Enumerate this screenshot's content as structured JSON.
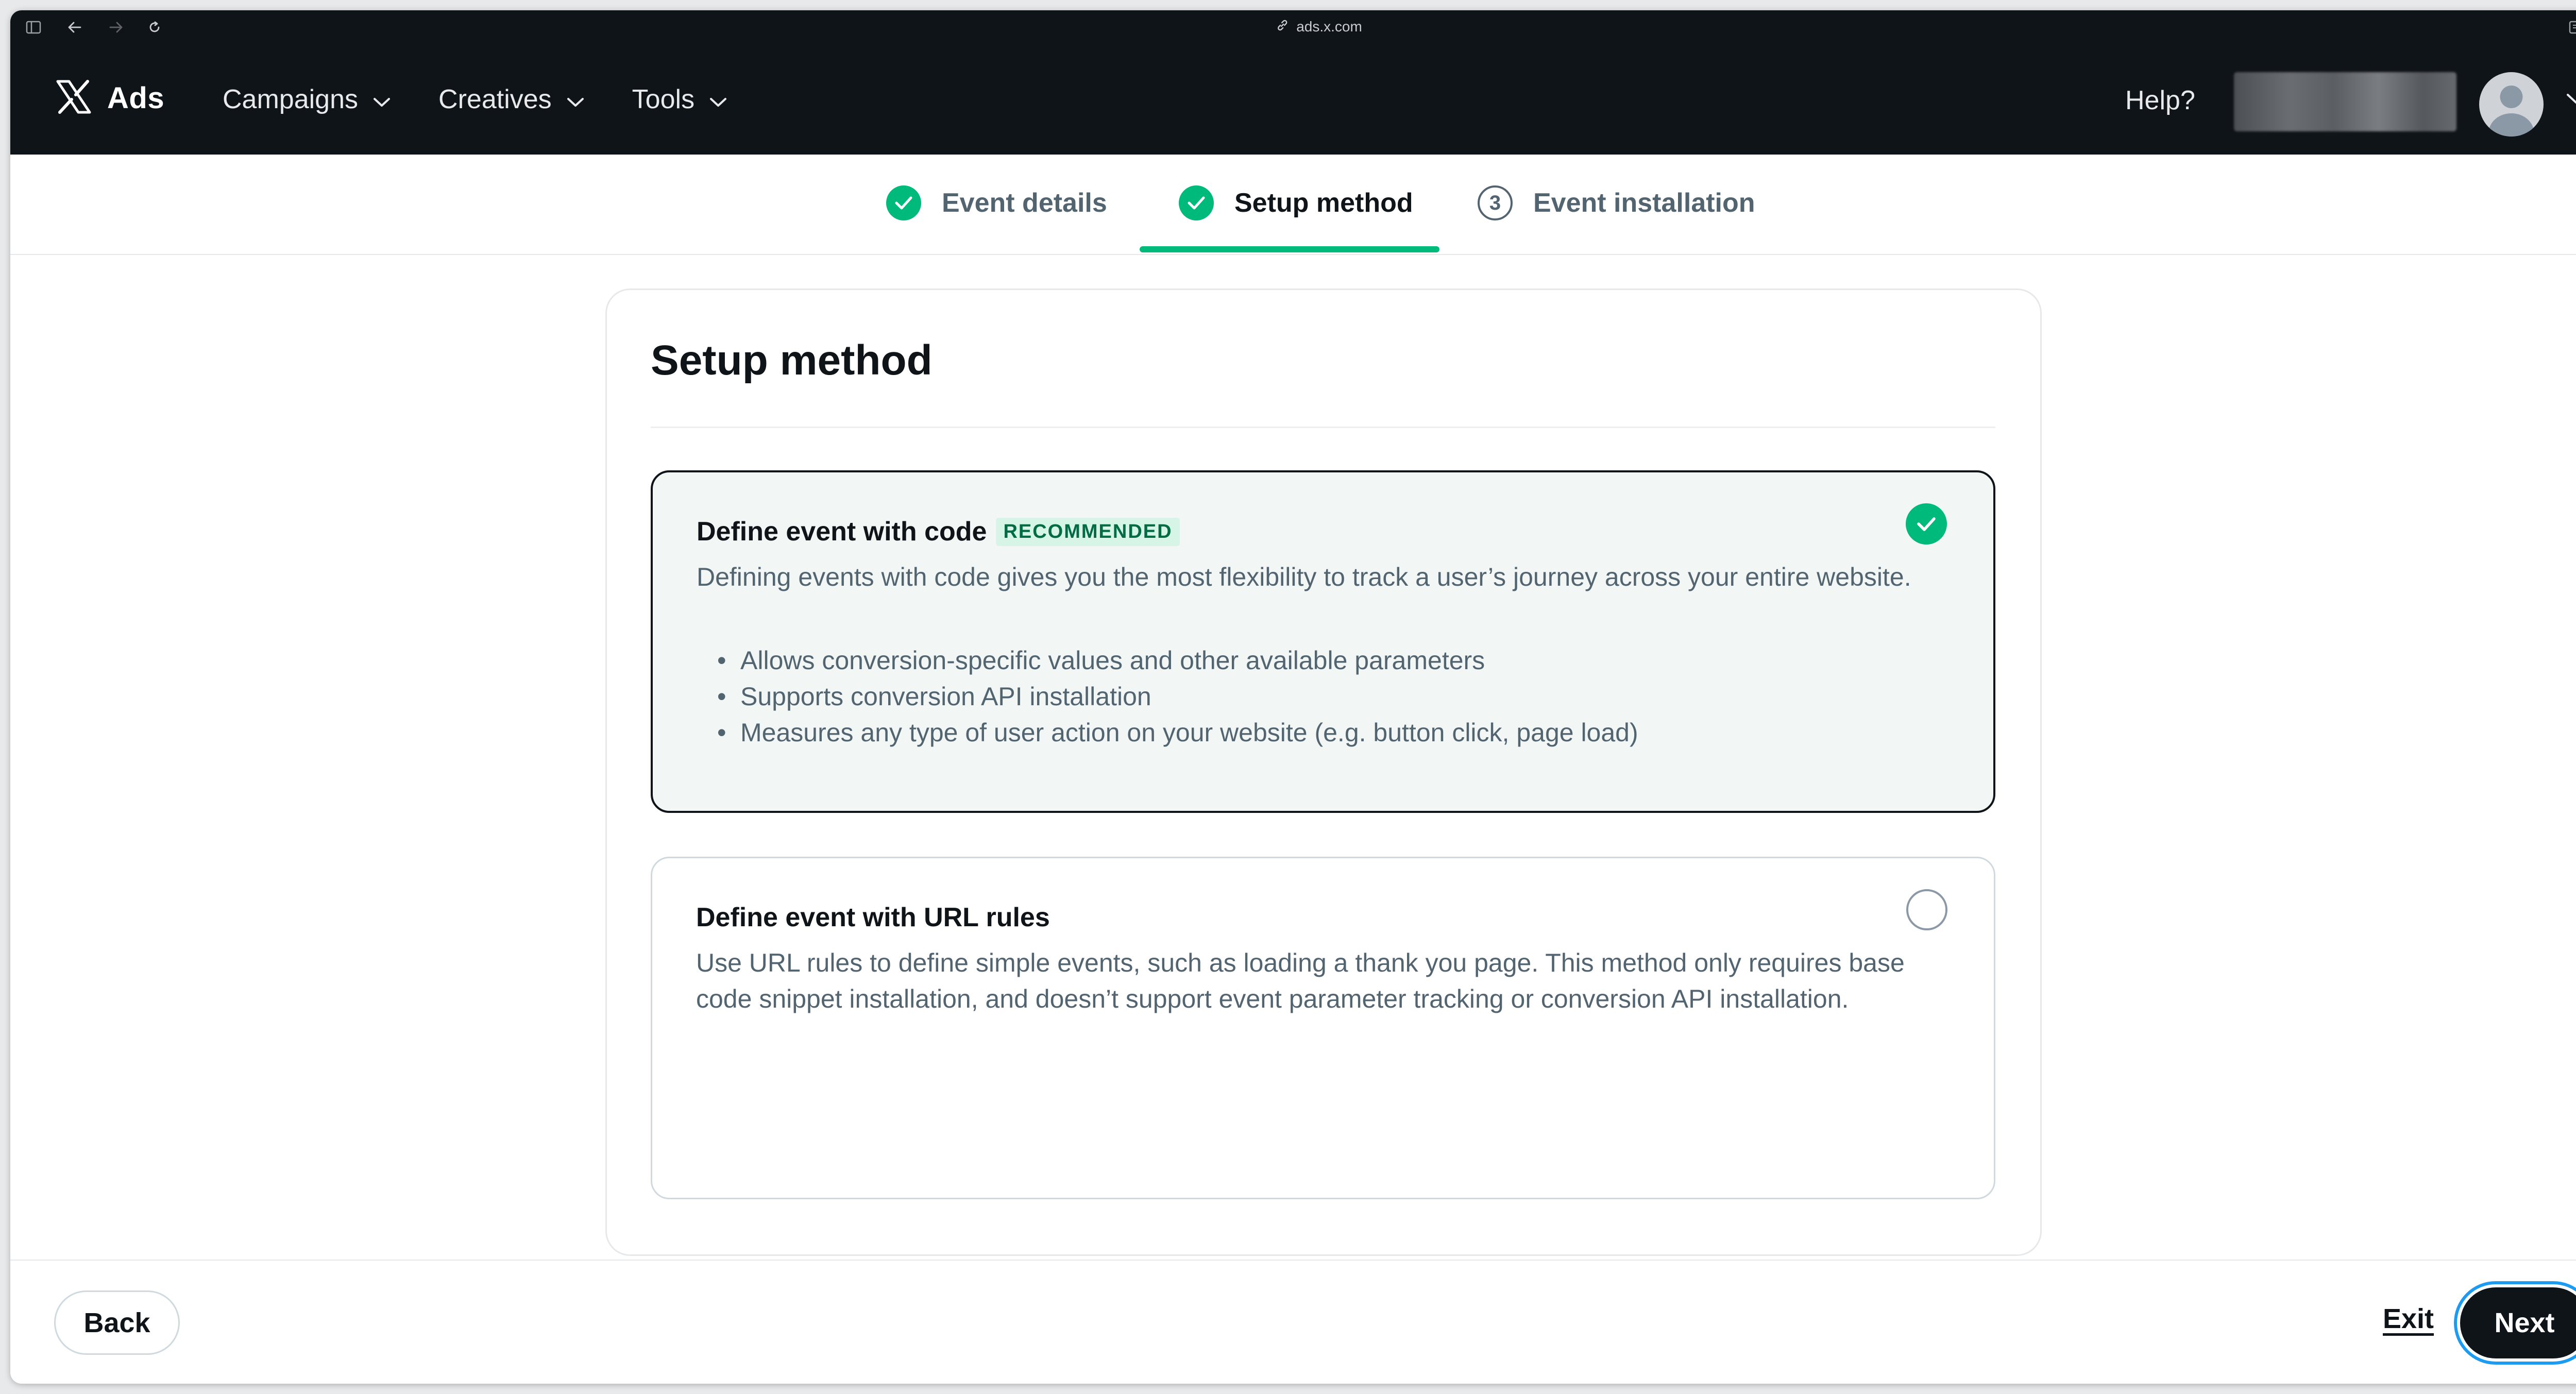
{
  "browser": {
    "url": "ads.x.com"
  },
  "nav": {
    "brand": "Ads",
    "menu": [
      {
        "label": "Campaigns"
      },
      {
        "label": "Creatives"
      },
      {
        "label": "Tools"
      }
    ],
    "help": "Help?"
  },
  "steps": [
    {
      "label": "Event details",
      "state": "done"
    },
    {
      "label": "Setup method",
      "state": "active"
    },
    {
      "label": "Event installation",
      "state": "pending",
      "number": "3"
    }
  ],
  "card": {
    "title": "Setup method",
    "options": [
      {
        "title": "Define event with code",
        "badge": "RECOMMENDED",
        "description": "Defining events with code gives you the most flexibility to track a user’s journey across your entire website.",
        "bullets": [
          "Allows conversion-specific values and other available parameters",
          "Supports conversion API installation",
          "Measures any type of user action on your website (e.g. button click, page load)"
        ],
        "selected": true
      },
      {
        "title": "Define event with URL rules",
        "description": "Use URL rules to define simple events, such as loading a thank you page. This method only requires base code snippet installation, and doesn’t support event parameter tracking or conversion API installation.",
        "selected": false
      }
    ]
  },
  "footer": {
    "back": "Back",
    "exit": "Exit",
    "next": "Next"
  },
  "colors": {
    "nav_bg": "#0f1419",
    "accent_green": "#00ba7c",
    "focus_ring": "#1d9bf0",
    "badge_bg": "#d6f5e6"
  }
}
